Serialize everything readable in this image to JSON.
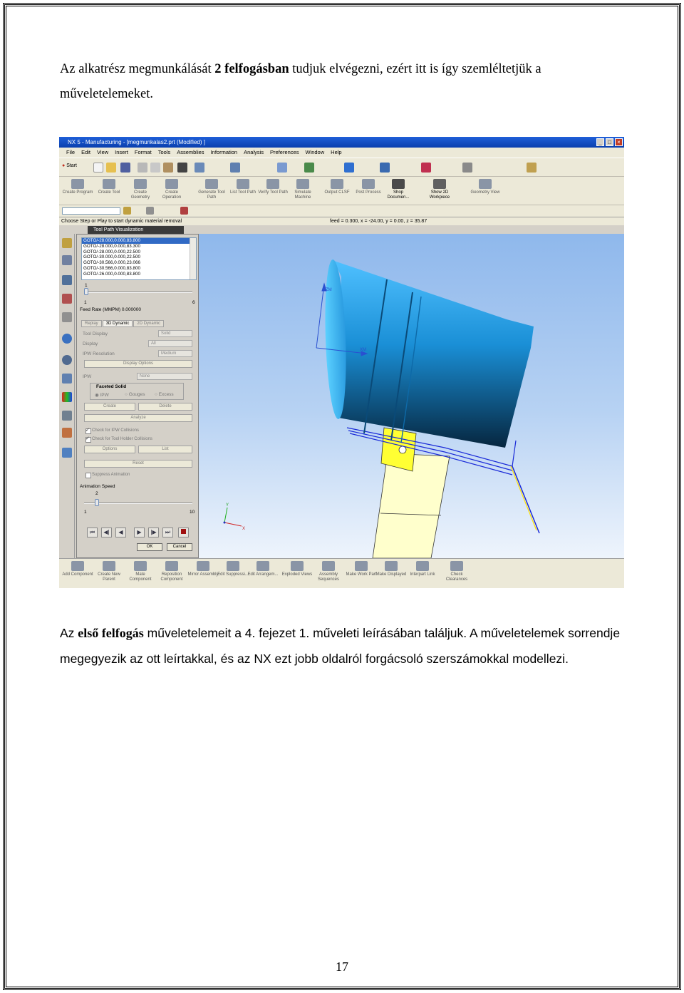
{
  "paragraph1": {
    "t1": "Az alkatrész megmunkálását ",
    "b1": "2 felfogásban",
    "t2": " tudjuk elvégezni, ezért itt is így szemléltetjük a műveletelemeket."
  },
  "paragraph2": {
    "t1": "Az ",
    "b1": "első felfogás",
    "t2": " műveletelemeit a 4. fejezet 1. műveleti leírásában találjuk. A műveletelemek sorrendje megegyezik az ott leírtakkal, és az NX ezt jobb oldalról forgácsoló szerszámokkal modellezi."
  },
  "page_number": "17",
  "screenshot": {
    "window_title": "NX 5 - Manufacturing - [megmunkalas2.prt (Modified) ]",
    "menu": [
      "File",
      "Edit",
      "View",
      "Insert",
      "Format",
      "Tools",
      "Assemblies",
      "Information",
      "Analysis",
      "Preferences",
      "Window",
      "Help"
    ],
    "start_label": "Start",
    "toolbar2": [
      "Create Program",
      "Create Tool",
      "Create Geometry",
      "Create Operation",
      "Generate Tool Path",
      "List Tool Path",
      "Verify Tool Path",
      "Simulate Machine",
      "Output CLSF",
      "Post Process",
      "Shop Documen...",
      "Show 2D Workpiece",
      "Geometry View"
    ],
    "status_left": "Choose Step or Play to start dynamic material removal",
    "status_right": "feed = 0.300, x = -24.00, y = 0.00, z = 35.87",
    "dialog_title": "Tool Path Visualization",
    "goto_lines": [
      "GOTO/-28.000,0.000,83.800",
      "GOTO/-28.000,0.000,83.300",
      "GOTO/-28.000,0.000,22.500",
      "GOTO/-30.000,0.000,22.500",
      "GOTO/-30.566,0.000,23.066",
      "GOTO/-30.566,0.000,83.800",
      "GOTO/-26.000,0.000,83.800"
    ],
    "slider1_value": "1",
    "slider1_min": "1",
    "slider1_max": "6",
    "feed_rate_label": "Feed Rate (MMPM)",
    "feed_rate_value": "0.000000",
    "tabs": [
      "Replay",
      "3D Dynamic",
      "2D Dynamic"
    ],
    "tool_display_label": "Tool Display",
    "tool_display_value": "Solid",
    "display_label": "Display",
    "display_value": "All",
    "ipw_resolution_label": "IPW Resolution",
    "ipw_resolution_value": "Medium",
    "display_options": "Display Options",
    "ipw_label": "IPW",
    "ipw_value": "None",
    "faceted_solid": "Faceted Solid",
    "radio_ipw": "IPW",
    "radio_gouges": "Gouges",
    "radio_excess": "Excess",
    "create": "Create",
    "delete": "Delete",
    "analyze": "Analyze",
    "check_ipw": "Check for IPW Collisions",
    "check_holder": "Check for Tool Holder Collisions",
    "options": "Options",
    "list": "List",
    "reset": "Reset",
    "suppress_animation": "Suppress Animation",
    "animation_speed": "Animation Speed",
    "anim_value": "2",
    "anim_min": "1",
    "anim_max": "10",
    "ok": "OK",
    "cancel": "Cancel",
    "axis_x": "X",
    "axis_y": "Y",
    "axis_zm": "ZM",
    "axis_xm": "XM",
    "bottom_toolbar": [
      "Add Component",
      "Create New Parent",
      "Mate Component",
      "Reposition Component",
      "Mirror Assembly",
      "Edit Suppressi...",
      "Edit Arrangem...",
      "Exploded Views",
      "Assembly Sequences",
      "Make Work Part",
      "Make Displayed",
      "Interpart Link",
      "Check Clearances"
    ]
  }
}
